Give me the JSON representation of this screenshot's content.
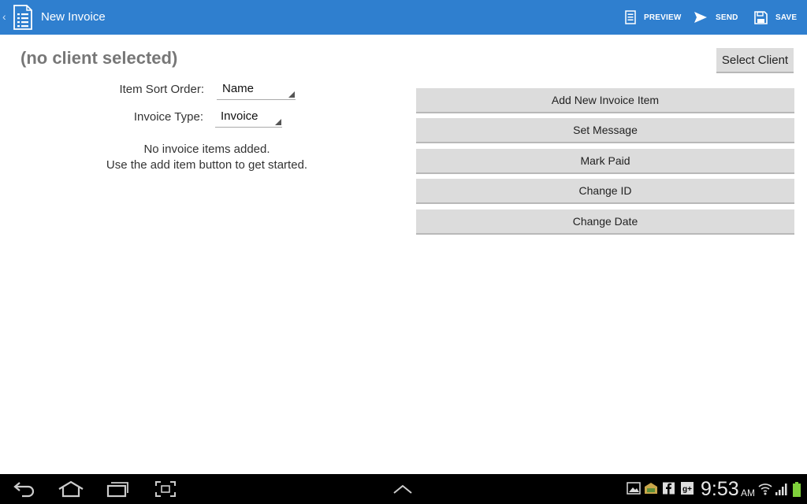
{
  "action_bar": {
    "title": "New Invoice",
    "actions": {
      "preview": "PREVIEW",
      "send": "SEND",
      "save": "SAVE"
    },
    "color": "#2f7fcf"
  },
  "client": {
    "name": "(no client selected)",
    "select_label": "Select Client"
  },
  "form": {
    "sort_order": {
      "label": "Item Sort Order:",
      "value": "Name"
    },
    "invoice_type": {
      "label": "Invoice Type:",
      "value": "Invoice"
    }
  },
  "empty_state": {
    "line1": "No invoice items added.",
    "line2": "Use the add item button to get started."
  },
  "buttons": {
    "add_item": "Add New Invoice Item",
    "set_message": "Set Message",
    "mark_paid": "Mark Paid",
    "change_id": "Change ID",
    "change_date": "Change Date"
  },
  "system_bar": {
    "time": "9:53",
    "ampm": "AM",
    "icons": [
      "back-icon",
      "home-icon",
      "recent-apps-icon",
      "screenshot-icon",
      "up-chevron-icon",
      "gallery-icon",
      "store-icon",
      "facebook-icon",
      "google-plus-icon",
      "wifi-icon",
      "signal-icon",
      "battery-icon"
    ]
  }
}
